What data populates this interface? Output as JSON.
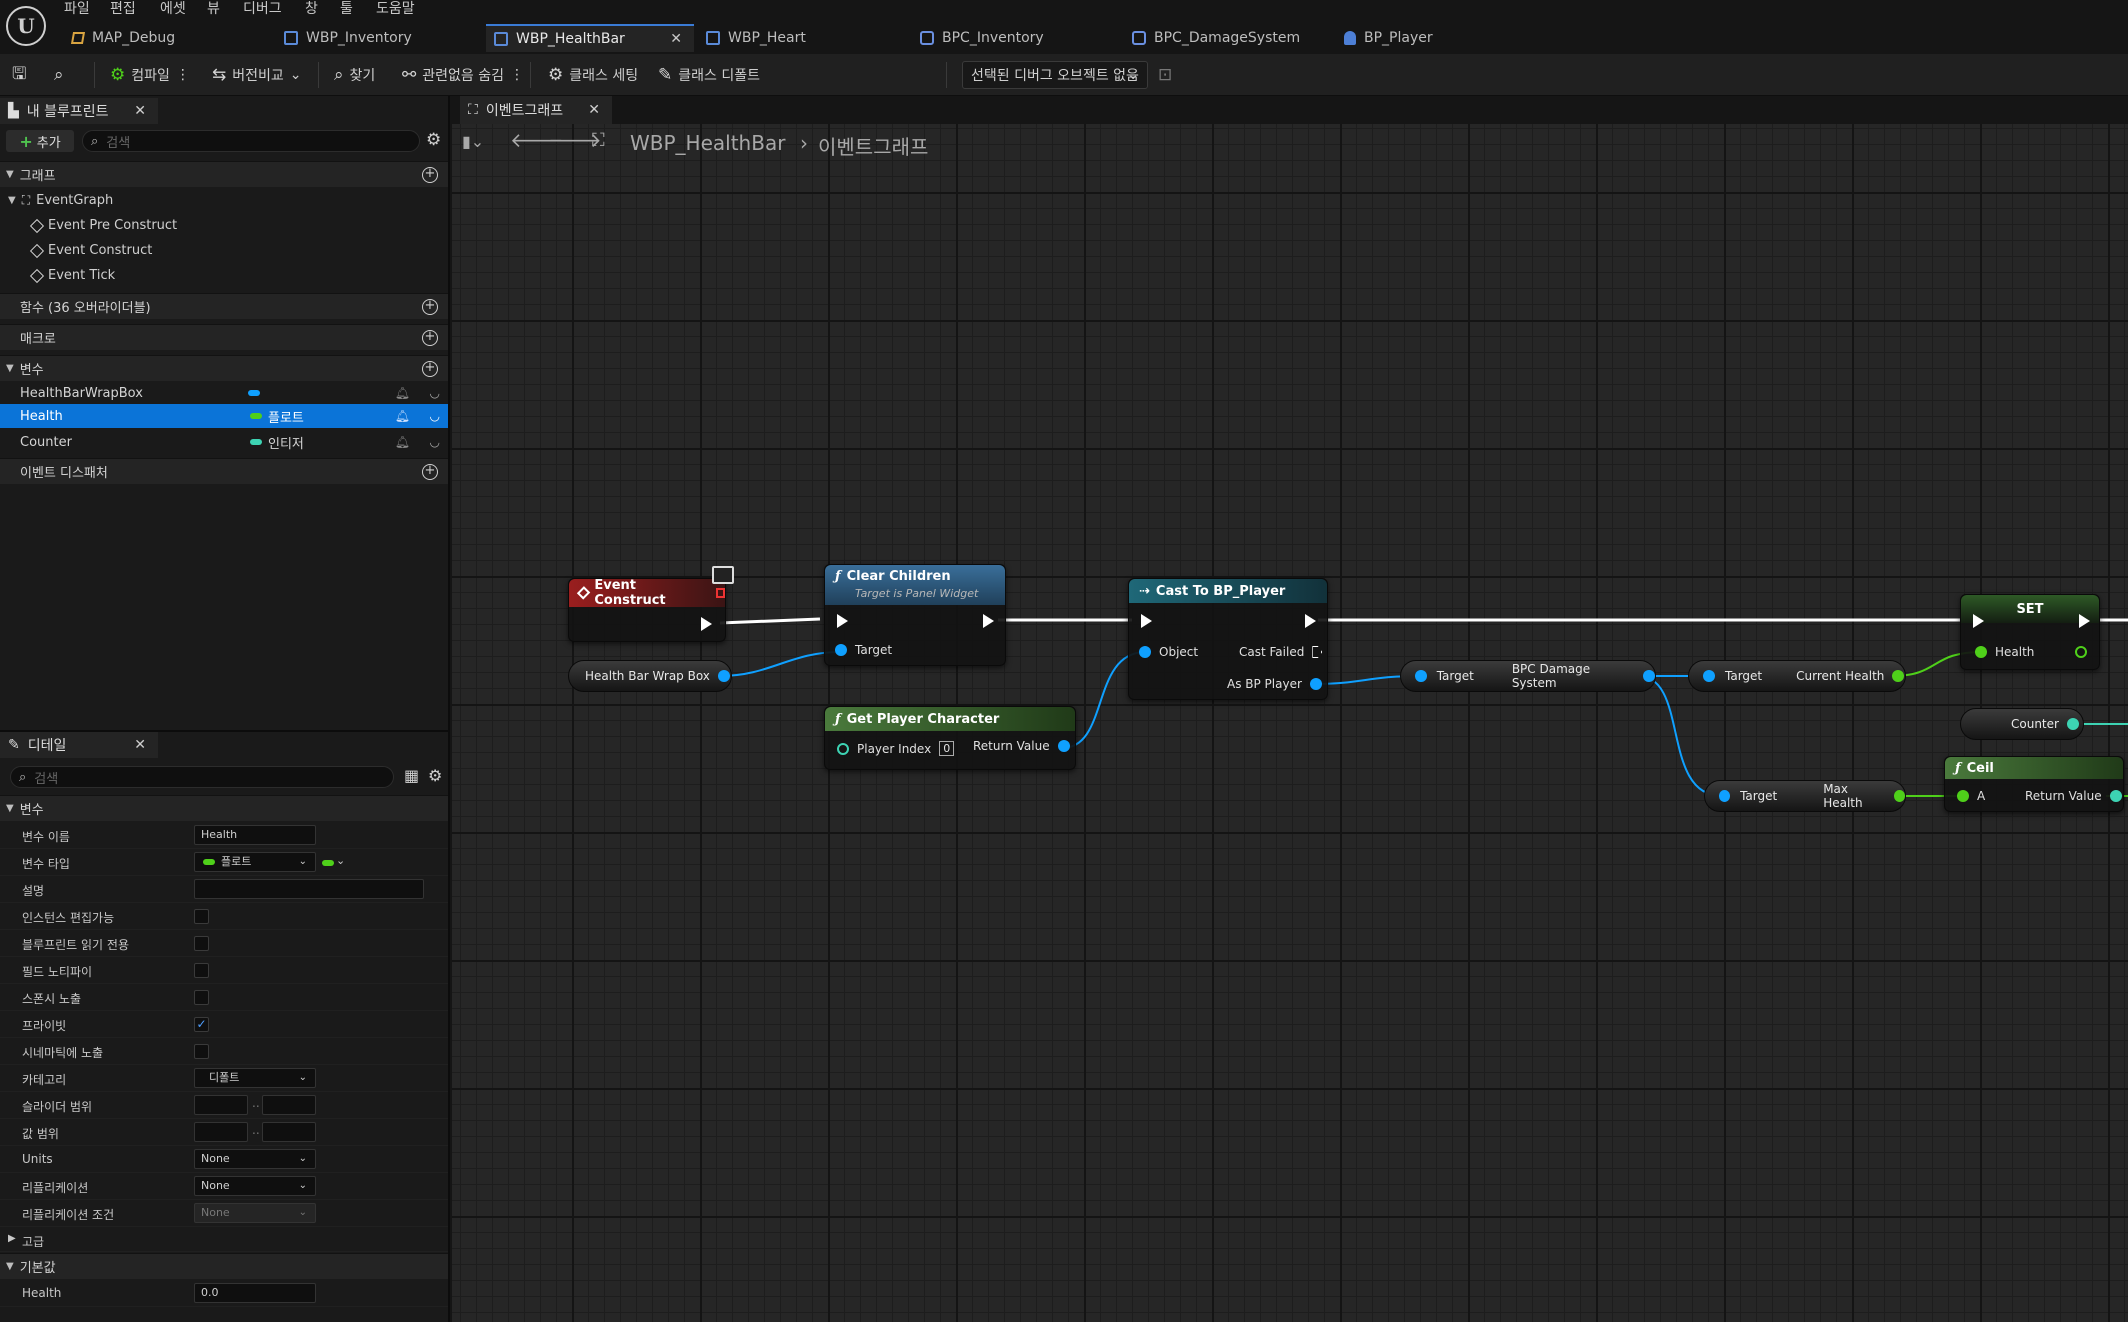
{
  "menu": [
    "파일",
    "편집",
    "에셋",
    "뷰",
    "디버그",
    "창",
    "툴",
    "도움말"
  ],
  "tabs": [
    {
      "label": "MAP_Debug",
      "icon": "level-icon"
    },
    {
      "label": "WBP_Inventory",
      "icon": "widget-blueprint-icon"
    },
    {
      "label": "WBP_HealthBar",
      "icon": "widget-blueprint-icon",
      "active": true
    },
    {
      "label": "WBP_Heart",
      "icon": "widget-blueprint-icon"
    },
    {
      "label": "BPC_Inventory",
      "icon": "component-blueprint-icon"
    },
    {
      "label": "BPC_DamageSystem",
      "icon": "component-blueprint-icon"
    },
    {
      "label": "BP_Player",
      "icon": "pawn-blueprint-icon"
    }
  ],
  "toolbar": {
    "compile": "컴파일",
    "diff": "버전비교",
    "find": "찾기",
    "hide_unrelated": "관련없음 숨김",
    "class_settings": "클래스 세팅",
    "class_defaults": "클래스 디폴트",
    "debug_object": "선택된 디버그 오브젝트 없음"
  },
  "my_blueprint": {
    "tab": "내 블루프린트",
    "add": "추가",
    "search_placeholder": "검색",
    "graphs_label": "그래프",
    "event_graph": "EventGraph",
    "events": [
      "Event Pre Construct",
      "Event Construct",
      "Event Tick"
    ],
    "functions_label": "함수 (36 오버라이더블)",
    "macros_label": "매크로",
    "variables_label": "변수",
    "variables": [
      {
        "name": "HealthBarWrapBox",
        "type": "",
        "color": "#0fa0ff"
      },
      {
        "name": "Health",
        "type": "플로트",
        "color": "#4fd01a",
        "selected": true
      },
      {
        "name": "Counter",
        "type": "인티저",
        "color": "#3dd3b3"
      }
    ],
    "dispatchers_label": "이벤트 디스패처"
  },
  "details": {
    "tab": "디테일",
    "search_placeholder": "검색",
    "section": "변수",
    "rows": {
      "name_label": "변수 이름",
      "name_value": "Health",
      "type_label": "변수 타입",
      "type_value": "플로트",
      "desc_label": "설명",
      "instance_editable": "인스턴스 편집가능",
      "bp_readonly": "블루프린트 읽기 전용",
      "field_notify": "필드 노티파이",
      "expose_spawn": "스폰시 노출",
      "private": "프라이빗",
      "expose_cinematics": "시네마틱에 노출",
      "category_label": "카테고리",
      "category_value": "디폴트",
      "slider_range": "슬라이더 범위",
      "value_range": "값 범위",
      "units_label": "Units",
      "units_value": "None",
      "replication_label": "리플리케이션",
      "replication_value": "None",
      "rep_condition_label": "리플리케이션 조건",
      "rep_condition_value": "None",
      "advanced": "고급"
    },
    "private_checked": true,
    "defaults_section": "기본값",
    "default_health_label": "Health",
    "default_health_value": "0.0"
  },
  "graph": {
    "tab": "이벤트그래프",
    "breadcrumb_bp": "WBP_HealthBar",
    "breadcrumb_graph": "이벤트그래프",
    "nodes": {
      "event_construct": "Event Construct",
      "clear_children": "Clear Children",
      "clear_children_sub": "Target is Panel Widget",
      "target": "Target",
      "health_bar_wrap_box": "Health Bar Wrap Box",
      "get_player_character": "Get Player Character",
      "player_index": "Player Index",
      "player_index_value": "0",
      "return_value": "Return Value",
      "cast": "Cast To BP_Player",
      "object": "Object",
      "cast_failed": "Cast Failed",
      "as_bp_player": "As BP Player",
      "bpc_damage_system": "BPC Damage System",
      "current_health": "Current Health",
      "max_health": "Max Health",
      "set": "SET",
      "health": "Health",
      "counter": "Counter",
      "ceil": "Ceil",
      "a": "A"
    }
  },
  "colors": {
    "selected": "#0b74d8",
    "object_pin": "#0fa0ff",
    "float_pin": "#4fd01a",
    "int_pin": "#3dd3b3",
    "event_head": "#8a1c1c",
    "function_head": "#2f5f86",
    "cast_head": "#1d5a6a",
    "pure_head": "#3a5a32"
  }
}
